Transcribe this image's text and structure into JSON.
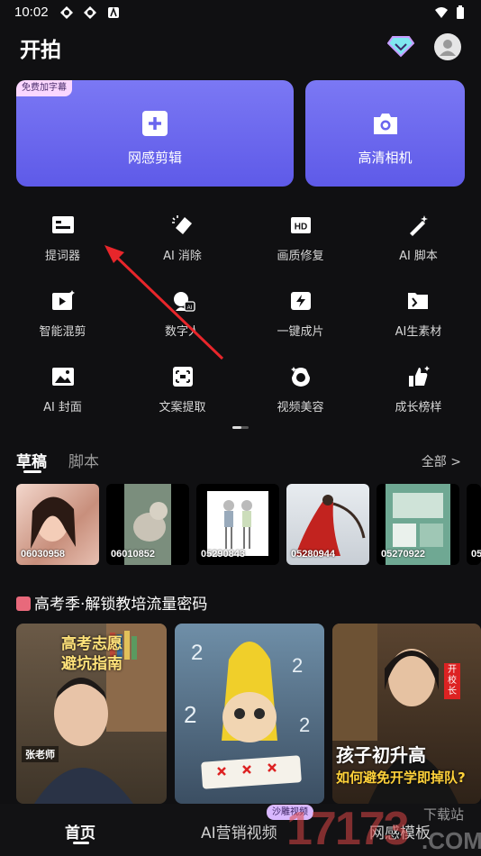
{
  "status": {
    "time": "10:02"
  },
  "header": {
    "title": "开拍"
  },
  "cards": [
    {
      "label": "网感剪辑",
      "badge": "免费加字幕"
    },
    {
      "label": "高清相机"
    }
  ],
  "tools": [
    {
      "label": "提词器"
    },
    {
      "label": "AI 消除"
    },
    {
      "label": "画质修复"
    },
    {
      "label": "AI 脚本"
    },
    {
      "label": "智能混剪"
    },
    {
      "label": "数字人"
    },
    {
      "label": "一键成片"
    },
    {
      "label": "AI生素材"
    },
    {
      "label": "AI 封面"
    },
    {
      "label": "文案提取"
    },
    {
      "label": "视频美容"
    },
    {
      "label": "成长榜样"
    }
  ],
  "drafts_tabs": {
    "tab1": "草稿",
    "tab2": "脚本",
    "see_all": "全部 >"
  },
  "drafts": [
    {
      "code": "06030958"
    },
    {
      "code": "06010852"
    },
    {
      "code": "05290843"
    },
    {
      "code": "05280944"
    },
    {
      "code": "05270922"
    },
    {
      "code": "05"
    }
  ],
  "section": {
    "title": "高考季·解锁教培流量密码"
  },
  "thumbs": [
    {
      "line1": "高考志愿",
      "line2": "避坑指南",
      "name": "张老师"
    },
    {
      "line1": ""
    },
    {
      "badge": "开校长",
      "line1": "孩子初升高",
      "line2": "如何避免开学即掉队?"
    }
  ],
  "bottom_nav": {
    "home": "首页",
    "ai_video": "AI营销视频",
    "badge": "沙雕视频",
    "templates": "网感模板"
  },
  "watermark": {
    "big": "17173",
    "small1": "下载站",
    "small2": ".COM"
  }
}
